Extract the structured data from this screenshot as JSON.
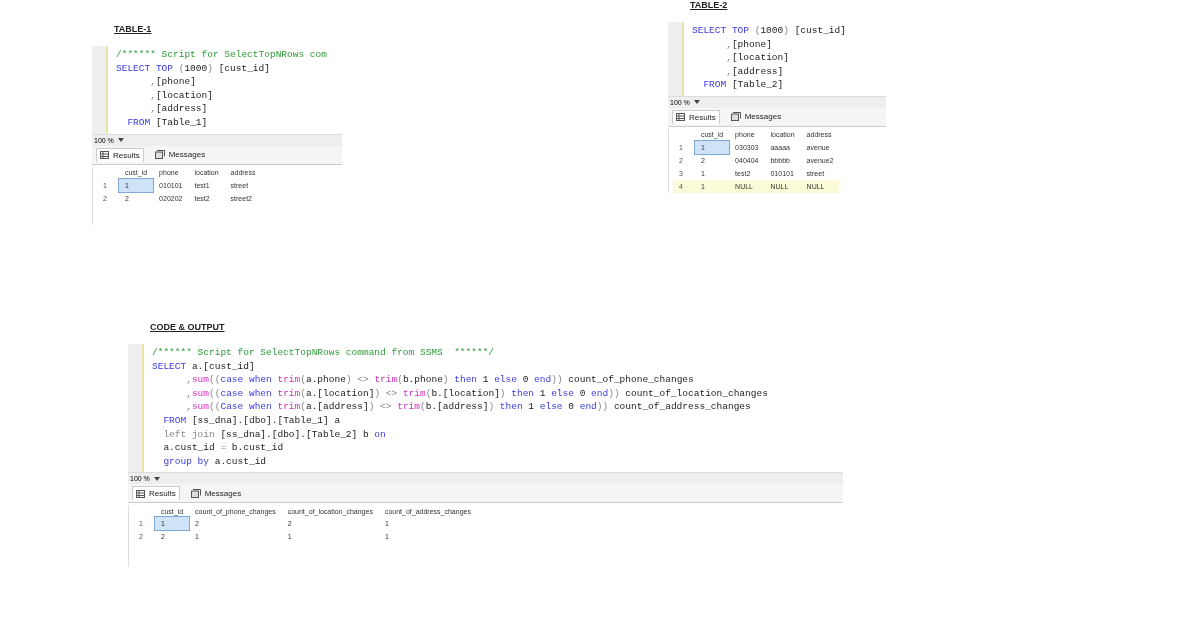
{
  "panels": [
    {
      "title": "TABLE-1",
      "code": [
        [
          {
            "kind": "cm",
            "text": "/****** Script for SelectTopNRows com"
          }
        ],
        [
          {
            "kind": "kw",
            "text": "SELECT TOP "
          },
          {
            "kind": "gr",
            "text": "("
          },
          {
            "kind": "tx",
            "text": "1000"
          },
          {
            "kind": "gr",
            "text": ") "
          },
          {
            "kind": "tx",
            "text": "[cust_id]"
          }
        ],
        [
          {
            "kind": "gr",
            "text": "      ,"
          },
          {
            "kind": "tx",
            "text": "[phone]"
          }
        ],
        [
          {
            "kind": "gr",
            "text": "      ,"
          },
          {
            "kind": "tx",
            "text": "[location]"
          }
        ],
        [
          {
            "kind": "gr",
            "text": "      ,"
          },
          {
            "kind": "tx",
            "text": "[address]"
          }
        ],
        [
          {
            "kind": "kw",
            "text": "  FROM "
          },
          {
            "kind": "tx",
            "text": "[Table_1]"
          }
        ]
      ],
      "zoom": "100 %",
      "tabs": [
        {
          "label": "Results",
          "selected": true
        },
        {
          "label": "Messages",
          "selected": false
        }
      ],
      "columns": [
        "cust_id",
        "phone",
        "location",
        "address"
      ],
      "rows": [
        {
          "number": "1",
          "new_row": false,
          "cells": [
            {
              "text": "1",
              "selected": true
            },
            {
              "text": "010101",
              "selected": false
            },
            {
              "text": "test1",
              "selected": false
            },
            {
              "text": "street",
              "selected": false
            }
          ]
        },
        {
          "number": "2",
          "new_row": false,
          "cells": [
            {
              "text": "2",
              "selected": false
            },
            {
              "text": "020202",
              "selected": false
            },
            {
              "text": "test2",
              "selected": false
            },
            {
              "text": "street2",
              "selected": false
            }
          ]
        }
      ]
    },
    {
      "title": "TABLE-2",
      "code": [
        [
          {
            "kind": "kw",
            "text": "SELECT TOP "
          },
          {
            "kind": "gr",
            "text": "("
          },
          {
            "kind": "tx",
            "text": "1000"
          },
          {
            "kind": "gr",
            "text": ") "
          },
          {
            "kind": "tx",
            "text": "[cust_id]"
          }
        ],
        [
          {
            "kind": "gr",
            "text": "      ,"
          },
          {
            "kind": "tx",
            "text": "[phone]"
          }
        ],
        [
          {
            "kind": "gr",
            "text": "      ,"
          },
          {
            "kind": "tx",
            "text": "[location]"
          }
        ],
        [
          {
            "kind": "gr",
            "text": "      ,"
          },
          {
            "kind": "tx",
            "text": "[address]"
          }
        ],
        [
          {
            "kind": "kw",
            "text": "  FROM "
          },
          {
            "kind": "tx",
            "text": "[Table_2]"
          }
        ]
      ],
      "zoom": "100 %",
      "tabs": [
        {
          "label": "Results",
          "selected": true
        },
        {
          "label": "Messages",
          "selected": false
        }
      ],
      "columns": [
        "cust_id",
        "phone",
        "location",
        "address"
      ],
      "rows": [
        {
          "number": "1",
          "new_row": false,
          "cells": [
            {
              "text": "1",
              "selected": true
            },
            {
              "text": "030303",
              "selected": false
            },
            {
              "text": "aaaaa",
              "selected": false
            },
            {
              "text": "avenue",
              "selected": false
            }
          ]
        },
        {
          "number": "2",
          "new_row": false,
          "cells": [
            {
              "text": "2",
              "selected": false
            },
            {
              "text": "040404",
              "selected": false
            },
            {
              "text": "bbbbb",
              "selected": false
            },
            {
              "text": "avenue2",
              "selected": false
            }
          ]
        },
        {
          "number": "3",
          "new_row": false,
          "cells": [
            {
              "text": "1",
              "selected": false
            },
            {
              "text": "test2",
              "selected": false
            },
            {
              "text": "010101",
              "selected": false
            },
            {
              "text": "street",
              "selected": false
            }
          ]
        },
        {
          "number": "4",
          "new_row": true,
          "cells": [
            {
              "text": "1",
              "selected": false
            },
            {
              "text": "NULL",
              "selected": false
            },
            {
              "text": "NULL",
              "selected": false
            },
            {
              "text": "NULL",
              "selected": false
            }
          ]
        }
      ]
    },
    {
      "title": "CODE & OUTPUT",
      "code": [
        [
          {
            "kind": "cm",
            "text": "/****** Script for SelectTopNRows command from SSMS  ******/"
          }
        ],
        [
          {
            "kind": "kw",
            "text": "SELECT "
          },
          {
            "kind": "tx",
            "text": "a.[cust_id]"
          }
        ],
        [
          {
            "kind": "gr",
            "text": "      ,"
          },
          {
            "kind": "fn",
            "text": "sum"
          },
          {
            "kind": "gr",
            "text": "(("
          },
          {
            "kind": "kw",
            "text": "case when "
          },
          {
            "kind": "fn",
            "text": "trim"
          },
          {
            "kind": "gr",
            "text": "("
          },
          {
            "kind": "tx",
            "text": "a.phone"
          },
          {
            "kind": "gr",
            "text": ") <> "
          },
          {
            "kind": "fn",
            "text": "trim"
          },
          {
            "kind": "gr",
            "text": "("
          },
          {
            "kind": "tx",
            "text": "b.phone"
          },
          {
            "kind": "gr",
            "text": ") "
          },
          {
            "kind": "kw",
            "text": "then "
          },
          {
            "kind": "tx",
            "text": "1 "
          },
          {
            "kind": "kw",
            "text": "else "
          },
          {
            "kind": "tx",
            "text": "0 "
          },
          {
            "kind": "kw",
            "text": "end"
          },
          {
            "kind": "gr",
            "text": ")) "
          },
          {
            "kind": "tx",
            "text": "count_of_phone_changes"
          }
        ],
        [
          {
            "kind": "gr",
            "text": "      ,"
          },
          {
            "kind": "fn",
            "text": "sum"
          },
          {
            "kind": "gr",
            "text": "(("
          },
          {
            "kind": "kw",
            "text": "case when "
          },
          {
            "kind": "fn",
            "text": "trim"
          },
          {
            "kind": "gr",
            "text": "("
          },
          {
            "kind": "tx",
            "text": "a.[location]"
          },
          {
            "kind": "gr",
            "text": ") <> "
          },
          {
            "kind": "fn",
            "text": "trim"
          },
          {
            "kind": "gr",
            "text": "("
          },
          {
            "kind": "tx",
            "text": "b.[location]"
          },
          {
            "kind": "gr",
            "text": ") "
          },
          {
            "kind": "kw",
            "text": "then "
          },
          {
            "kind": "tx",
            "text": "1 "
          },
          {
            "kind": "kw",
            "text": "else "
          },
          {
            "kind": "tx",
            "text": "0 "
          },
          {
            "kind": "kw",
            "text": "end"
          },
          {
            "kind": "gr",
            "text": ")) "
          },
          {
            "kind": "tx",
            "text": "count_of_location_changes"
          }
        ],
        [
          {
            "kind": "gr",
            "text": "      ,"
          },
          {
            "kind": "fn",
            "text": "sum"
          },
          {
            "kind": "gr",
            "text": "(("
          },
          {
            "kind": "kw",
            "text": "Case when "
          },
          {
            "kind": "fn",
            "text": "trim"
          },
          {
            "kind": "gr",
            "text": "("
          },
          {
            "kind": "tx",
            "text": "a.[address]"
          },
          {
            "kind": "gr",
            "text": ") <> "
          },
          {
            "kind": "fn",
            "text": "trim"
          },
          {
            "kind": "gr",
            "text": "("
          },
          {
            "kind": "tx",
            "text": "b.[address]"
          },
          {
            "kind": "gr",
            "text": ") "
          },
          {
            "kind": "kw",
            "text": "then "
          },
          {
            "kind": "tx",
            "text": "1 "
          },
          {
            "kind": "kw",
            "text": "else "
          },
          {
            "kind": "tx",
            "text": "0 "
          },
          {
            "kind": "kw",
            "text": "end"
          },
          {
            "kind": "gr",
            "text": ")) "
          },
          {
            "kind": "tx",
            "text": "count_of_address_changes"
          }
        ],
        [
          {
            "kind": "kw",
            "text": "  FROM "
          },
          {
            "kind": "tx",
            "text": "[ss_dna].[dbo].[Table_1] a"
          }
        ],
        [
          {
            "kind": "gr",
            "text": "  left join "
          },
          {
            "kind": "tx",
            "text": "[ss_dna].[dbo].[Table_2] b "
          },
          {
            "kind": "kw",
            "text": "on"
          }
        ],
        [
          {
            "kind": "tx",
            "text": "  a.cust_id "
          },
          {
            "kind": "gr",
            "text": "= "
          },
          {
            "kind": "tx",
            "text": "b.cust_id"
          }
        ],
        [
          {
            "kind": "kw",
            "text": "  group by "
          },
          {
            "kind": "tx",
            "text": "a.cust_id"
          }
        ]
      ],
      "zoom": "100 %",
      "tabs": [
        {
          "label": "Results",
          "selected": true
        },
        {
          "label": "Messages",
          "selected": false
        }
      ],
      "columns": [
        "cust_id",
        "count_of_phone_changes",
        "count_of_location_changes",
        "count_of_address_changes"
      ],
      "rows": [
        {
          "number": "1",
          "new_row": false,
          "cells": [
            {
              "text": "1",
              "selected": true
            },
            {
              "text": "2",
              "selected": false
            },
            {
              "text": "2",
              "selected": false
            },
            {
              "text": "1",
              "selected": false
            }
          ]
        },
        {
          "number": "2",
          "new_row": false,
          "cells": [
            {
              "text": "2",
              "selected": false
            },
            {
              "text": "1",
              "selected": false
            },
            {
              "text": "1",
              "selected": false
            },
            {
              "text": "1",
              "selected": false
            }
          ]
        }
      ]
    }
  ]
}
